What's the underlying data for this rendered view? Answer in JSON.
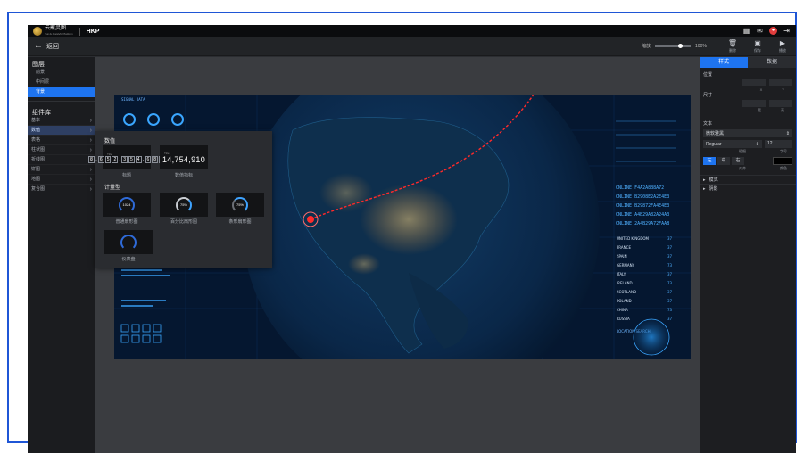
{
  "app": {
    "logo_text": "云聚灵图",
    "logo_subtext": "YunJu DataVis Platform",
    "project_name": "HKP"
  },
  "subbar": {
    "back_label": "返回",
    "zoom_label": "缩放",
    "zoom_value": "100%",
    "zoom_fraction": 0.65,
    "actions": [
      {
        "icon": "trash-icon",
        "label": "删除"
      },
      {
        "icon": "save-icon",
        "label": "保存"
      },
      {
        "icon": "play-icon",
        "label": "播放"
      }
    ]
  },
  "sidebar": {
    "layers_heading": "图层",
    "layers": [
      "前景",
      "中间层",
      "背景"
    ],
    "active_layer_index": 2,
    "library_heading": "组件库",
    "components": [
      "基本",
      "数值",
      "表格",
      "柱状图",
      "折线图",
      "饼图",
      "地图",
      "复合图"
    ],
    "active_component_index": 1
  },
  "popup": {
    "heading": "数值",
    "items": [
      {
        "label": "标题",
        "mini_title": "Title",
        "digits": [
          "8",
          ",",
          "6",
          "5",
          "2",
          ",",
          "3",
          "5",
          "4",
          ",",
          "6",
          "8",
          "0"
        ]
      },
      {
        "label": "数值指标",
        "mini_title": "Title",
        "value": "14,754,910"
      }
    ],
    "gauge_heading": "计量型",
    "gauges": [
      {
        "label": "普通扇形图",
        "value": "1024"
      },
      {
        "label": "百分比扇形图",
        "value": "75%"
      },
      {
        "label": "条形扇形图",
        "value": "75%"
      },
      {
        "label": "仪表盘",
        "value": ""
      }
    ]
  },
  "canvas": {
    "signal_label": "SIGNAL DATA",
    "online_lines": [
      "ONLINE F4A2A8B8A72",
      "ONLINE B2908E2A2E4E3",
      "ONLINE B29872FA4E4E3",
      "ONLINE A4B29A82A24A3",
      "ONLINE 2A4B29A72FAAB"
    ],
    "countries": [
      {
        "name": "UNITED KINGDOM",
        "value": "37"
      },
      {
        "name": "FRANCE",
        "value": "37"
      },
      {
        "name": "SPAIN",
        "value": "37"
      },
      {
        "name": "GERMANY",
        "value": "73"
      },
      {
        "name": "ITALY",
        "value": "37"
      },
      {
        "name": "IRELAND",
        "value": "73"
      },
      {
        "name": "SCOTLAND",
        "value": "37"
      },
      {
        "name": "POLAND",
        "value": "37"
      },
      {
        "name": "CHINA",
        "value": "73"
      },
      {
        "name": "RUSSIA",
        "value": "37"
      }
    ],
    "location_search": "LOCATION SEARCH"
  },
  "rpanel": {
    "tabs": [
      "样式",
      "数据"
    ],
    "active_tab_index": 0,
    "position_label": "位置",
    "position_caps": [
      "X",
      "Y"
    ],
    "size_label": "尺寸",
    "size_caps": [
      "宽",
      "高"
    ],
    "text_label": "文本",
    "font_family": "微软雅黑",
    "font_weight": "Regular",
    "font_size": "12",
    "weight_cap": "粗细",
    "size_cap": "字号",
    "style_buttons": [
      "左",
      "中",
      "右"
    ],
    "active_style_index": 0,
    "align_cap": "对齐",
    "color_cap": "颜色",
    "text_color": "#000000",
    "sections": [
      "模式",
      "阴影"
    ]
  },
  "colors": {
    "accent": "#1e74f0",
    "frame": "#1f56d6",
    "route": "#ff2a2a"
  }
}
